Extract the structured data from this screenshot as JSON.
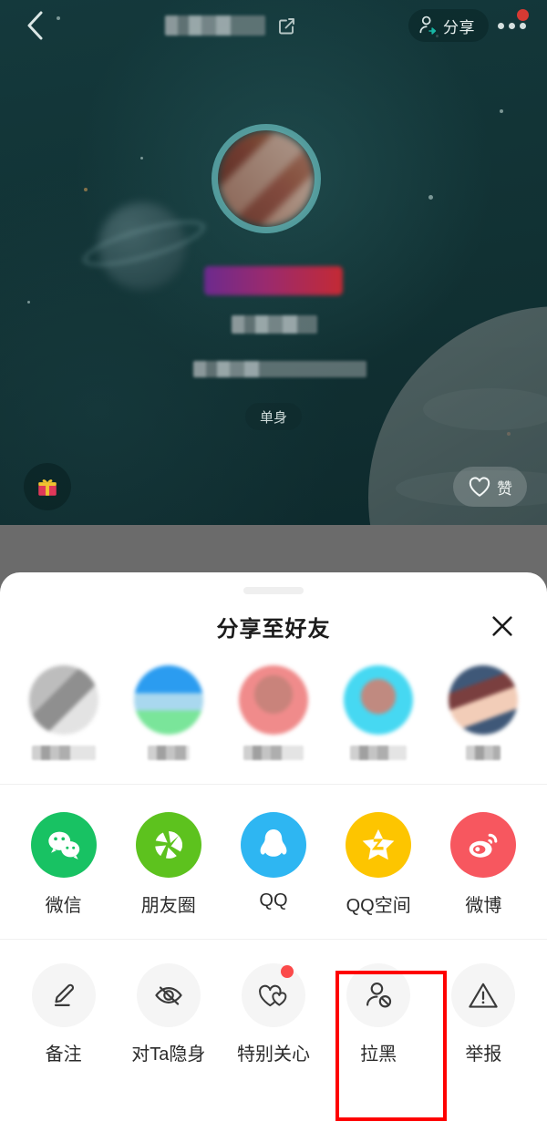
{
  "theme": {
    "profile_bg": "#123436",
    "dim_overlay": "#6b6b6b",
    "sheet_bg": "#ffffff",
    "highlight_color": "#fe0000",
    "badge_red": "#fb4a4a",
    "accent_teal": "#5caaac"
  },
  "profile": {
    "back_icon": "chevron-left-icon",
    "nickname": "",
    "nickname_redacted": true,
    "edit_icon": "edit-square-icon",
    "share_button": {
      "label": "分享",
      "icon": "person-share-icon"
    },
    "more_icon": "more-dots-icon",
    "more_has_badge": true,
    "avatar": "user-avatar",
    "name_badge_redacted": true,
    "info_lines_redacted": true,
    "status_tag": "单身",
    "gift_icon": "gift-icon",
    "like_button": {
      "label": "赞",
      "icon": "heart-icon"
    }
  },
  "sheet": {
    "title": "分享至好友",
    "close_icon": "close-icon",
    "grabber": "drag-handle",
    "friends": [
      {
        "name": "",
        "redacted": true,
        "av1": "#bdbdbd",
        "av2": "#8f8f8f",
        "av3": "#e3e3e3"
      },
      {
        "name": "",
        "redacted": true,
        "av1": "#2b9cf0",
        "av2": "#a9d8ef",
        "av3": "#7ae59a"
      },
      {
        "name": "",
        "redacted": true,
        "av1": "#f08b8b",
        "av2": "#c9837b",
        "av3": "#f5c6c6"
      },
      {
        "name": "",
        "redacted": true,
        "av1": "#46d8f2",
        "av2": "#c08a80",
        "av3": "#bfeff8"
      },
      {
        "name": "",
        "redacted": true,
        "av1": "#3f5878",
        "av2": "#7a3f3f",
        "av3": "#f2cdb8"
      }
    ],
    "apps": [
      {
        "label": "微信",
        "icon": "wechat-icon",
        "color": "#18c263"
      },
      {
        "label": "朋友圈",
        "icon": "moments-icon",
        "color": "#5dc21e"
      },
      {
        "label": "QQ",
        "icon": "qq-icon",
        "color": "#2eb6f2"
      },
      {
        "label": "QQ空间",
        "icon": "qzone-icon",
        "color": "#fdc500"
      },
      {
        "label": "微博",
        "icon": "weibo-icon",
        "color": "#f7575f"
      }
    ],
    "actions": [
      {
        "label": "备注",
        "icon": "pencil-icon",
        "badge": false,
        "highlighted": false
      },
      {
        "label": "对Ta隐身",
        "icon": "eye-off-icon",
        "badge": false,
        "highlighted": false
      },
      {
        "label": "特别关心",
        "icon": "two-hearts-icon",
        "badge": true,
        "highlighted": false
      },
      {
        "label": "拉黑",
        "icon": "person-block-icon",
        "badge": false,
        "highlighted": true
      },
      {
        "label": "举报",
        "icon": "warning-icon",
        "badge": false,
        "highlighted": false
      }
    ]
  }
}
